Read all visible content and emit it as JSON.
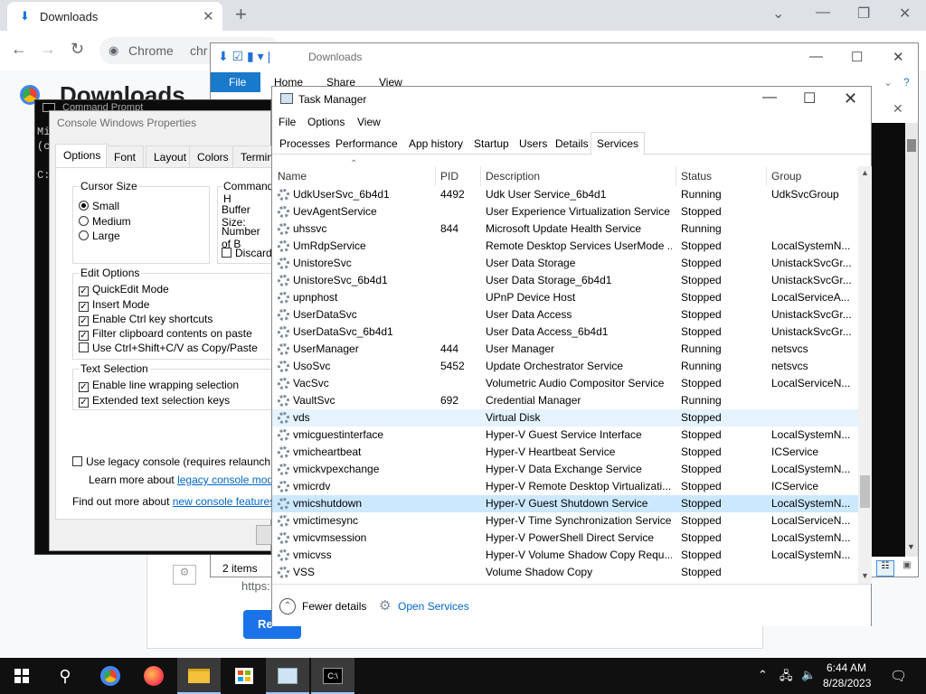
{
  "chrome": {
    "tab_title": "Downloads",
    "omnibox_prefix": "Chrome",
    "omnibox_text": "chr",
    "page_title": "Downloads",
    "download_url_fragment": "https:",
    "retry_label": "Re"
  },
  "explorer": {
    "title": "Downloads",
    "ribbon": {
      "file": "File",
      "home": "Home",
      "share": "Share",
      "view": "View"
    },
    "status": "2 items"
  },
  "cmd": {
    "title": "Command Prompt",
    "line1": "Mi",
    "line2": "(c",
    "line3": "C:"
  },
  "console_props": {
    "title": "Console Windows Properties",
    "tabs": [
      "Options",
      "Font",
      "Layout",
      "Colors",
      "Termina"
    ],
    "cursor_size": {
      "label": "Cursor Size",
      "options": [
        "Small",
        "Medium",
        "Large"
      ],
      "selected": "Small"
    },
    "command_history": {
      "label": "Command H",
      "buffer_size": "Buffer Size:",
      "number_of": "Number of B",
      "discard": "Discard"
    },
    "edit_options": {
      "label": "Edit Options",
      "items": [
        {
          "label": "QuickEdit Mode",
          "checked": true
        },
        {
          "label": "Insert Mode",
          "checked": true
        },
        {
          "label": "Enable Ctrl key shortcuts",
          "checked": true
        },
        {
          "label": "Filter clipboard contents on paste",
          "checked": true
        },
        {
          "label": "Use Ctrl+Shift+C/V as Copy/Paste",
          "checked": false
        }
      ]
    },
    "text_selection": {
      "label": "Text Selection",
      "items": [
        {
          "label": "Enable line wrapping selection",
          "checked": true
        },
        {
          "label": "Extended text selection keys",
          "checked": true
        }
      ]
    },
    "legacy": "Use legacy console (requires relaunch, affe",
    "learn_more": "Learn more about",
    "learn_more_link": "legacy console mode",
    "find_out": "Find out more about",
    "find_out_link": "new console features"
  },
  "task_manager": {
    "title": "Task Manager",
    "menu": [
      "File",
      "Options",
      "View"
    ],
    "tabs": [
      "Processes",
      "Performance",
      "App history",
      "Startup",
      "Users",
      "Details",
      "Services"
    ],
    "active_tab": "Services",
    "columns": [
      "Name",
      "PID",
      "Description",
      "Status",
      "Group"
    ],
    "rows": [
      {
        "name": "UdkUserSvc_6b4d1",
        "pid": "4492",
        "desc": "Udk User Service_6b4d1",
        "status": "Running",
        "group": "UdkSvcGroup"
      },
      {
        "name": "UevAgentService",
        "pid": "",
        "desc": "User Experience Virtualization Service",
        "status": "Stopped",
        "group": ""
      },
      {
        "name": "uhssvc",
        "pid": "844",
        "desc": "Microsoft Update Health Service",
        "status": "Running",
        "group": ""
      },
      {
        "name": "UmRdpService",
        "pid": "",
        "desc": "Remote Desktop Services UserMode ...",
        "status": "Stopped",
        "group": "LocalSystemN..."
      },
      {
        "name": "UnistoreSvc",
        "pid": "",
        "desc": "User Data Storage",
        "status": "Stopped",
        "group": "UnistackSvcGr..."
      },
      {
        "name": "UnistoreSvc_6b4d1",
        "pid": "",
        "desc": "User Data Storage_6b4d1",
        "status": "Stopped",
        "group": "UnistackSvcGr..."
      },
      {
        "name": "upnphost",
        "pid": "",
        "desc": "UPnP Device Host",
        "status": "Stopped",
        "group": "LocalServiceA..."
      },
      {
        "name": "UserDataSvc",
        "pid": "",
        "desc": "User Data Access",
        "status": "Stopped",
        "group": "UnistackSvcGr..."
      },
      {
        "name": "UserDataSvc_6b4d1",
        "pid": "",
        "desc": "User Data Access_6b4d1",
        "status": "Stopped",
        "group": "UnistackSvcGr..."
      },
      {
        "name": "UserManager",
        "pid": "444",
        "desc": "User Manager",
        "status": "Running",
        "group": "netsvcs"
      },
      {
        "name": "UsoSvc",
        "pid": "5452",
        "desc": "Update Orchestrator Service",
        "status": "Running",
        "group": "netsvcs"
      },
      {
        "name": "VacSvc",
        "pid": "",
        "desc": "Volumetric Audio Compositor Service",
        "status": "Stopped",
        "group": "LocalServiceN..."
      },
      {
        "name": "VaultSvc",
        "pid": "692",
        "desc": "Credential Manager",
        "status": "Running",
        "group": ""
      },
      {
        "name": "vds",
        "pid": "",
        "desc": "Virtual Disk",
        "status": "Stopped",
        "group": ""
      },
      {
        "name": "vmicguestinterface",
        "pid": "",
        "desc": "Hyper-V Guest Service Interface",
        "status": "Stopped",
        "group": "LocalSystemN..."
      },
      {
        "name": "vmicheartbeat",
        "pid": "",
        "desc": "Hyper-V Heartbeat Service",
        "status": "Stopped",
        "group": "ICService"
      },
      {
        "name": "vmickvpexchange",
        "pid": "",
        "desc": "Hyper-V Data Exchange Service",
        "status": "Stopped",
        "group": "LocalSystemN..."
      },
      {
        "name": "vmicrdv",
        "pid": "",
        "desc": "Hyper-V Remote Desktop Virtualizati...",
        "status": "Stopped",
        "group": "ICService"
      },
      {
        "name": "vmicshutdown",
        "pid": "",
        "desc": "Hyper-V Guest Shutdown Service",
        "status": "Stopped",
        "group": "LocalSystemN..."
      },
      {
        "name": "vmictimesync",
        "pid": "",
        "desc": "Hyper-V Time Synchronization Service",
        "status": "Stopped",
        "group": "LocalServiceN..."
      },
      {
        "name": "vmicvmsession",
        "pid": "",
        "desc": "Hyper-V PowerShell Direct Service",
        "status": "Stopped",
        "group": "LocalSystemN..."
      },
      {
        "name": "vmicvss",
        "pid": "",
        "desc": "Hyper-V Volume Shadow Copy Requ...",
        "status": "Stopped",
        "group": "LocalSystemN..."
      },
      {
        "name": "VSS",
        "pid": "",
        "desc": "Volume Shadow Copy",
        "status": "Stopped",
        "group": ""
      }
    ],
    "hover_row": "vds",
    "selected_row": "vmicshutdown",
    "fewer_details": "Fewer details",
    "open_services": "Open Services"
  },
  "taskbar": {
    "time": "6:44 AM",
    "date": "8/28/2023",
    "apps": [
      "start-icon",
      "search-icon",
      "chrome-icon",
      "firefox-icon",
      "file-explorer-icon",
      "store-icon",
      "task-manager-icon",
      "command-prompt-icon"
    ]
  },
  "colors": {
    "selection": "#cce8ff",
    "hover": "#e5f3ff",
    "link": "#0066cc",
    "ribbon_file": "#1979ca"
  }
}
